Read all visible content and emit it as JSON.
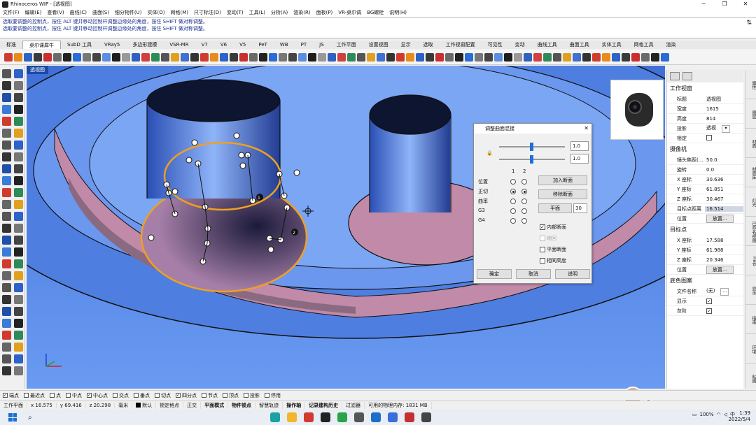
{
  "window": {
    "title": "Rhinoceros WIP - [透视图]"
  },
  "menu": [
    "文件(F)",
    "编辑(E)",
    "查看(V)",
    "曲线(C)",
    "曲面(S)",
    "细分物件(U)",
    "实体(O)",
    "网格(M)",
    "尺寸标注(D)",
    "变动(T)",
    "工具(L)",
    "分析(A)",
    "渲染(R)",
    "面板(P)",
    "VR-桌尔调",
    "BG螺栓",
    "说明(H)"
  ],
  "command": {
    "line1": "选取要调整的控制点，按住 ALT 键并移动控制杆调整边缘处的角度，按住 SHIFT 做对称调整。",
    "line2": "选取要调整的控制点，按住 ALT 键并移动控制杆调整边缘处的角度，按住 SHIFT 做对称调整。"
  },
  "tabs": [
    "标准",
    "桌尔课犀牛",
    "SubD 工具",
    "VRay5",
    "多边形建模",
    "VSR-MR",
    "V7",
    "V6",
    "V5",
    "PeT",
    "WB",
    "PT",
    "JS",
    "工作平面",
    "设置视图",
    "显示",
    "选取",
    "工作视窗配置",
    "可见性",
    "变动",
    "曲线工具",
    "曲面工具",
    "实体工具",
    "网格工具",
    "渲染"
  ],
  "active_tab": "桌尔课犀牛",
  "viewport": {
    "label": "透视图",
    "points": [
      "1",
      "2"
    ]
  },
  "dialog": {
    "title": "调整曲面混接",
    "slider1_value": "1.0",
    "slider2_value": "1.0",
    "col1": "1",
    "col2": "2",
    "rows": [
      "位置",
      "正切",
      "曲率",
      "G3",
      "G4"
    ],
    "btn_add": "加入断面",
    "btn_remove": "移除断面",
    "btn_flat": "平面",
    "flat_value": "30",
    "opt_inner": "内部断面",
    "opt_shrink": "缩回",
    "opt_plane": "平面断面",
    "opt_height": "相同高度",
    "ok": "确定",
    "cancel": "取消",
    "help": "说明"
  },
  "panel": {
    "viewport_title": "工作视窗",
    "rows": [
      {
        "k": "标题",
        "v": "透视图"
      },
      {
        "k": "宽度",
        "v": "1615"
      },
      {
        "k": "高度",
        "v": "814"
      },
      {
        "k": "投影",
        "v": "透视"
      },
      {
        "k": "锁定",
        "v": ""
      }
    ],
    "camera_title": "摄像机",
    "camera": [
      {
        "k": "镜头焦距(...",
        "v": "50.0"
      },
      {
        "k": "旋转",
        "v": "0.0"
      },
      {
        "k": "X 座标",
        "v": "30.636"
      },
      {
        "k": "Y 座标",
        "v": "61.851"
      },
      {
        "k": "Z 座标",
        "v": "30.467"
      },
      {
        "k": "目标点距离",
        "v": "16.514"
      },
      {
        "k": "位置",
        "v": "放置..."
      }
    ],
    "target_title": "目标点",
    "target": [
      {
        "k": "X 座标",
        "v": "17.588"
      },
      {
        "k": "Y 座标",
        "v": "61.988"
      },
      {
        "k": "Z 座标",
        "v": "20.346"
      },
      {
        "k": "位置",
        "v": "放置..."
      }
    ],
    "bg_title": "底色图案",
    "bg": [
      {
        "k": "文件名称",
        "v": "(无)"
      },
      {
        "k": "显示",
        "v": ""
      },
      {
        "k": "灰阶",
        "v": ""
      }
    ]
  },
  "sidetabs": [
    "属性",
    "图层",
    "材质",
    "材质库",
    "灯光",
    "已命名视图",
    "Help",
    "显示",
    "指南",
    "环境",
    "贴图"
  ],
  "osnaps": [
    {
      "label": "端点",
      "on": true
    },
    {
      "label": "最近点",
      "on": false
    },
    {
      "label": "点",
      "on": false
    },
    {
      "label": "中点",
      "on": false
    },
    {
      "label": "中心点",
      "on": true
    },
    {
      "label": "交点",
      "on": false
    },
    {
      "label": "垂点",
      "on": false
    },
    {
      "label": "切点",
      "on": false
    },
    {
      "label": "四分点",
      "on": true
    },
    {
      "label": "节点",
      "on": false
    },
    {
      "label": "顶点",
      "on": false
    },
    {
      "label": "投影",
      "on": false
    },
    {
      "label": "停用",
      "on": false
    }
  ],
  "status": {
    "cplane": "工作平面",
    "x": "x 16.575",
    "y": "y 69.416",
    "z": "z 20.298",
    "unit": "毫米",
    "layer": "默认",
    "lock": "锁定格点",
    "ortho": "正交",
    "planar": "平面模式",
    "osnap": "物件锁点",
    "smart": "智慧轨迹",
    "gumball": "操作轴",
    "history": "记录建构历史",
    "filter": "过滤器",
    "memory": "可用的物理内存: 1831 MB"
  },
  "taskbar": {
    "time": "1:39",
    "date": "2022/5/4",
    "battery": "100%",
    "ime": "英"
  }
}
